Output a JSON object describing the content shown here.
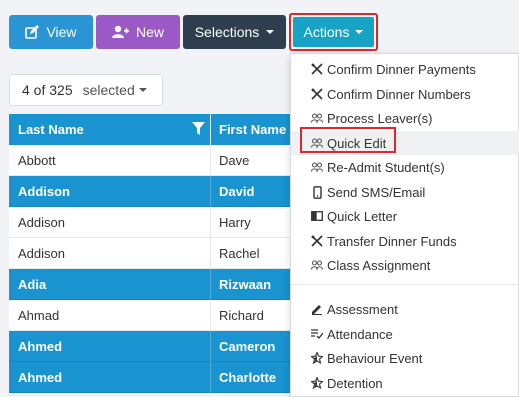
{
  "toolbar": {
    "view_label": "View",
    "new_label": "New",
    "selections_label": "Selections",
    "actions_label": "Actions"
  },
  "selection": {
    "count": "4 of 325",
    "selected_label": "selected"
  },
  "table": {
    "headers": {
      "last_name": "Last Name",
      "first_name": "First Name"
    },
    "rows": [
      {
        "last": "Abbott",
        "first": "Dave",
        "selected": false
      },
      {
        "last": "Addison",
        "first": "David",
        "selected": true
      },
      {
        "last": "Addison",
        "first": "Harry",
        "selected": false
      },
      {
        "last": "Addison",
        "first": "Rachel",
        "selected": false
      },
      {
        "last": "Adia",
        "first": "Rizwaan",
        "selected": true
      },
      {
        "last": "Ahmad",
        "first": "Richard",
        "selected": false
      },
      {
        "last": "Ahmed",
        "first": "Cameron",
        "selected": true
      },
      {
        "last": "Ahmed",
        "first": "Charlotte",
        "selected": true
      }
    ]
  },
  "menu": {
    "items": [
      {
        "label": "Confirm Dinner Payments",
        "icon": "cutlery-icon"
      },
      {
        "label": "Confirm Dinner Numbers",
        "icon": "cutlery-icon"
      },
      {
        "label": "Process Leaver(s)",
        "icon": "users-icon"
      },
      {
        "label": "Quick Edit",
        "icon": "users-icon"
      },
      {
        "label": "Re-Admit Student(s)",
        "icon": "users-icon"
      },
      {
        "label": "Send SMS/Email",
        "icon": "mobile-icon"
      },
      {
        "label": "Quick Letter",
        "icon": "letter-icon"
      },
      {
        "label": "Transfer Dinner Funds",
        "icon": "cutlery-icon"
      },
      {
        "label": "Class Assignment",
        "icon": "users-icon"
      },
      {
        "label": "Assessment",
        "icon": "pencil-icon"
      },
      {
        "label": "Attendance",
        "icon": "checklist-icon"
      },
      {
        "label": "Behaviour Event",
        "icon": "star-icon"
      },
      {
        "label": "Detention",
        "icon": "star-icon"
      }
    ]
  },
  "colors": {
    "primary_blue": "#1994d0",
    "new_purple": "#9b59c6",
    "dark_slate": "#2e3e4e",
    "actions_teal": "#17a3c6",
    "highlight_red": "#e0262b"
  }
}
